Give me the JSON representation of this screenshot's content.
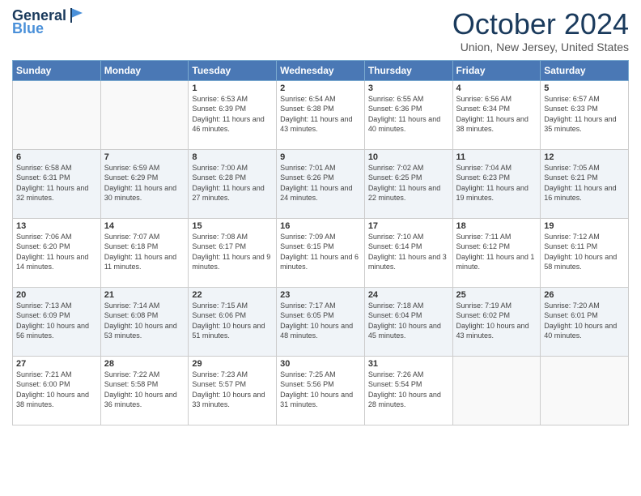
{
  "header": {
    "logo_line1": "General",
    "logo_line2": "Blue",
    "month": "October 2024",
    "location": "Union, New Jersey, United States"
  },
  "days_of_week": [
    "Sunday",
    "Monday",
    "Tuesday",
    "Wednesday",
    "Thursday",
    "Friday",
    "Saturday"
  ],
  "weeks": [
    [
      {
        "day": "",
        "info": ""
      },
      {
        "day": "",
        "info": ""
      },
      {
        "day": "1",
        "info": "Sunrise: 6:53 AM\nSunset: 6:39 PM\nDaylight: 11 hours and 46 minutes."
      },
      {
        "day": "2",
        "info": "Sunrise: 6:54 AM\nSunset: 6:38 PM\nDaylight: 11 hours and 43 minutes."
      },
      {
        "day": "3",
        "info": "Sunrise: 6:55 AM\nSunset: 6:36 PM\nDaylight: 11 hours and 40 minutes."
      },
      {
        "day": "4",
        "info": "Sunrise: 6:56 AM\nSunset: 6:34 PM\nDaylight: 11 hours and 38 minutes."
      },
      {
        "day": "5",
        "info": "Sunrise: 6:57 AM\nSunset: 6:33 PM\nDaylight: 11 hours and 35 minutes."
      }
    ],
    [
      {
        "day": "6",
        "info": "Sunrise: 6:58 AM\nSunset: 6:31 PM\nDaylight: 11 hours and 32 minutes."
      },
      {
        "day": "7",
        "info": "Sunrise: 6:59 AM\nSunset: 6:29 PM\nDaylight: 11 hours and 30 minutes."
      },
      {
        "day": "8",
        "info": "Sunrise: 7:00 AM\nSunset: 6:28 PM\nDaylight: 11 hours and 27 minutes."
      },
      {
        "day": "9",
        "info": "Sunrise: 7:01 AM\nSunset: 6:26 PM\nDaylight: 11 hours and 24 minutes."
      },
      {
        "day": "10",
        "info": "Sunrise: 7:02 AM\nSunset: 6:25 PM\nDaylight: 11 hours and 22 minutes."
      },
      {
        "day": "11",
        "info": "Sunrise: 7:04 AM\nSunset: 6:23 PM\nDaylight: 11 hours and 19 minutes."
      },
      {
        "day": "12",
        "info": "Sunrise: 7:05 AM\nSunset: 6:21 PM\nDaylight: 11 hours and 16 minutes."
      }
    ],
    [
      {
        "day": "13",
        "info": "Sunrise: 7:06 AM\nSunset: 6:20 PM\nDaylight: 11 hours and 14 minutes."
      },
      {
        "day": "14",
        "info": "Sunrise: 7:07 AM\nSunset: 6:18 PM\nDaylight: 11 hours and 11 minutes."
      },
      {
        "day": "15",
        "info": "Sunrise: 7:08 AM\nSunset: 6:17 PM\nDaylight: 11 hours and 9 minutes."
      },
      {
        "day": "16",
        "info": "Sunrise: 7:09 AM\nSunset: 6:15 PM\nDaylight: 11 hours and 6 minutes."
      },
      {
        "day": "17",
        "info": "Sunrise: 7:10 AM\nSunset: 6:14 PM\nDaylight: 11 hours and 3 minutes."
      },
      {
        "day": "18",
        "info": "Sunrise: 7:11 AM\nSunset: 6:12 PM\nDaylight: 11 hours and 1 minute."
      },
      {
        "day": "19",
        "info": "Sunrise: 7:12 AM\nSunset: 6:11 PM\nDaylight: 10 hours and 58 minutes."
      }
    ],
    [
      {
        "day": "20",
        "info": "Sunrise: 7:13 AM\nSunset: 6:09 PM\nDaylight: 10 hours and 56 minutes."
      },
      {
        "day": "21",
        "info": "Sunrise: 7:14 AM\nSunset: 6:08 PM\nDaylight: 10 hours and 53 minutes."
      },
      {
        "day": "22",
        "info": "Sunrise: 7:15 AM\nSunset: 6:06 PM\nDaylight: 10 hours and 51 minutes."
      },
      {
        "day": "23",
        "info": "Sunrise: 7:17 AM\nSunset: 6:05 PM\nDaylight: 10 hours and 48 minutes."
      },
      {
        "day": "24",
        "info": "Sunrise: 7:18 AM\nSunset: 6:04 PM\nDaylight: 10 hours and 45 minutes."
      },
      {
        "day": "25",
        "info": "Sunrise: 7:19 AM\nSunset: 6:02 PM\nDaylight: 10 hours and 43 minutes."
      },
      {
        "day": "26",
        "info": "Sunrise: 7:20 AM\nSunset: 6:01 PM\nDaylight: 10 hours and 40 minutes."
      }
    ],
    [
      {
        "day": "27",
        "info": "Sunrise: 7:21 AM\nSunset: 6:00 PM\nDaylight: 10 hours and 38 minutes."
      },
      {
        "day": "28",
        "info": "Sunrise: 7:22 AM\nSunset: 5:58 PM\nDaylight: 10 hours and 36 minutes."
      },
      {
        "day": "29",
        "info": "Sunrise: 7:23 AM\nSunset: 5:57 PM\nDaylight: 10 hours and 33 minutes."
      },
      {
        "day": "30",
        "info": "Sunrise: 7:25 AM\nSunset: 5:56 PM\nDaylight: 10 hours and 31 minutes."
      },
      {
        "day": "31",
        "info": "Sunrise: 7:26 AM\nSunset: 5:54 PM\nDaylight: 10 hours and 28 minutes."
      },
      {
        "day": "",
        "info": ""
      },
      {
        "day": "",
        "info": ""
      }
    ]
  ]
}
